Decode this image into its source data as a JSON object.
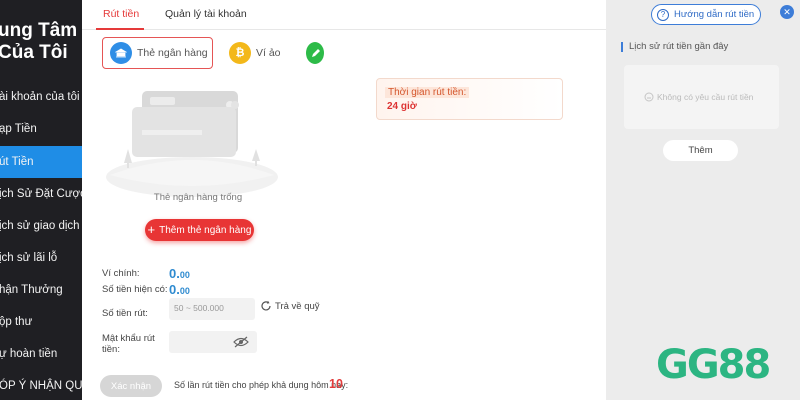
{
  "sidebar": {
    "title": "ung Tâm\nCủa Tôi",
    "items": [
      {
        "label": "ài khoản của tôi",
        "active": false
      },
      {
        "label": "ạp Tiền",
        "active": false
      },
      {
        "label": "út Tiền",
        "active": true
      },
      {
        "label": "ịch Sử Đặt Cược",
        "active": false
      },
      {
        "label": "ịch sử giao dịch",
        "active": false
      },
      {
        "label": "ịch sử lãi lỗ",
        "active": false
      },
      {
        "label": "hận Thưởng",
        "active": false
      },
      {
        "label": "ộp thư",
        "active": false
      },
      {
        "label": "ự hoàn tiền",
        "active": false
      },
      {
        "label": "ÓP Ý NHẬN QUÀ",
        "active": false
      }
    ]
  },
  "tabs": [
    "Rút tiền",
    "Quản lý tài khoản"
  ],
  "methods": {
    "bank": "Thẻ ngân hàng",
    "wallet": "Ví ảo"
  },
  "bank_empty": "Thẻ ngân hàng trống",
  "add_bank": "Thêm thẻ ngân hàng",
  "withdraw_time": {
    "label": "Thời gian rút tiền:",
    "value": "24 giờ"
  },
  "form": {
    "main_wallet_label": "Ví chính:",
    "main_wallet_value": "0.",
    "main_wallet_decimals": "00",
    "current_label": "Số tiền hiện có:",
    "current_value": "0.",
    "current_decimals": "00",
    "amount_label": "Số tiền rút:",
    "amount_placeholder": "50 ~ 500.000",
    "return_label": "Trả về quỹ",
    "password_label": "Mật khẩu rút tiền:",
    "confirm": "Xác nhận",
    "daily_limit_label": "Số lần rút tiền cho phép khả dụng hôm nay:",
    "daily_limit_value": "10"
  },
  "right_panel": {
    "guide": "Hướng dẫn rút tiền",
    "history_title": "Lịch sử rút tiền gần đây",
    "history_empty": "Không có yêu cầu rút tiền",
    "more": "Thêm"
  },
  "watermark": "GG88",
  "colors": {
    "accent_red": "#e83535",
    "active_blue": "#1f8de6",
    "sidebar_bg": "#1f1f23",
    "brand_green": "#2cb582"
  }
}
